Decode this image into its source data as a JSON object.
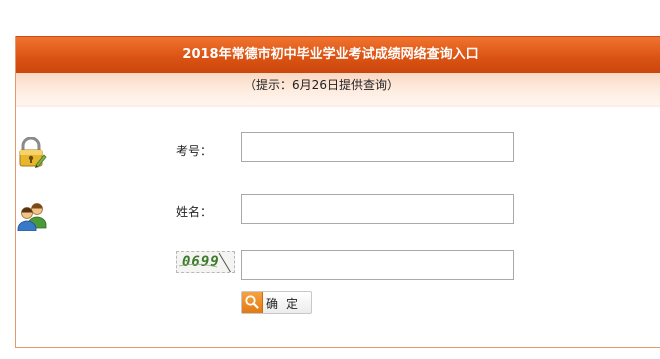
{
  "header": {
    "title": "2018年常德市初中毕业学业考试成绩网络查询入口",
    "hint": "（提示：6月26日提供查询）"
  },
  "form": {
    "exam_number_label": "考号：",
    "exam_number_value": "",
    "name_label": "姓名：",
    "name_value": "",
    "captcha_code": "0699",
    "captcha_value": "",
    "submit_label": "确定"
  },
  "icons": {
    "lock": "lock-pencil-icon",
    "users": "users-icon",
    "search": "magnifier-icon"
  },
  "colors": {
    "title_bar": "#dc5414",
    "hint_bar": "#fde9dc",
    "border": "#e49a6a"
  }
}
